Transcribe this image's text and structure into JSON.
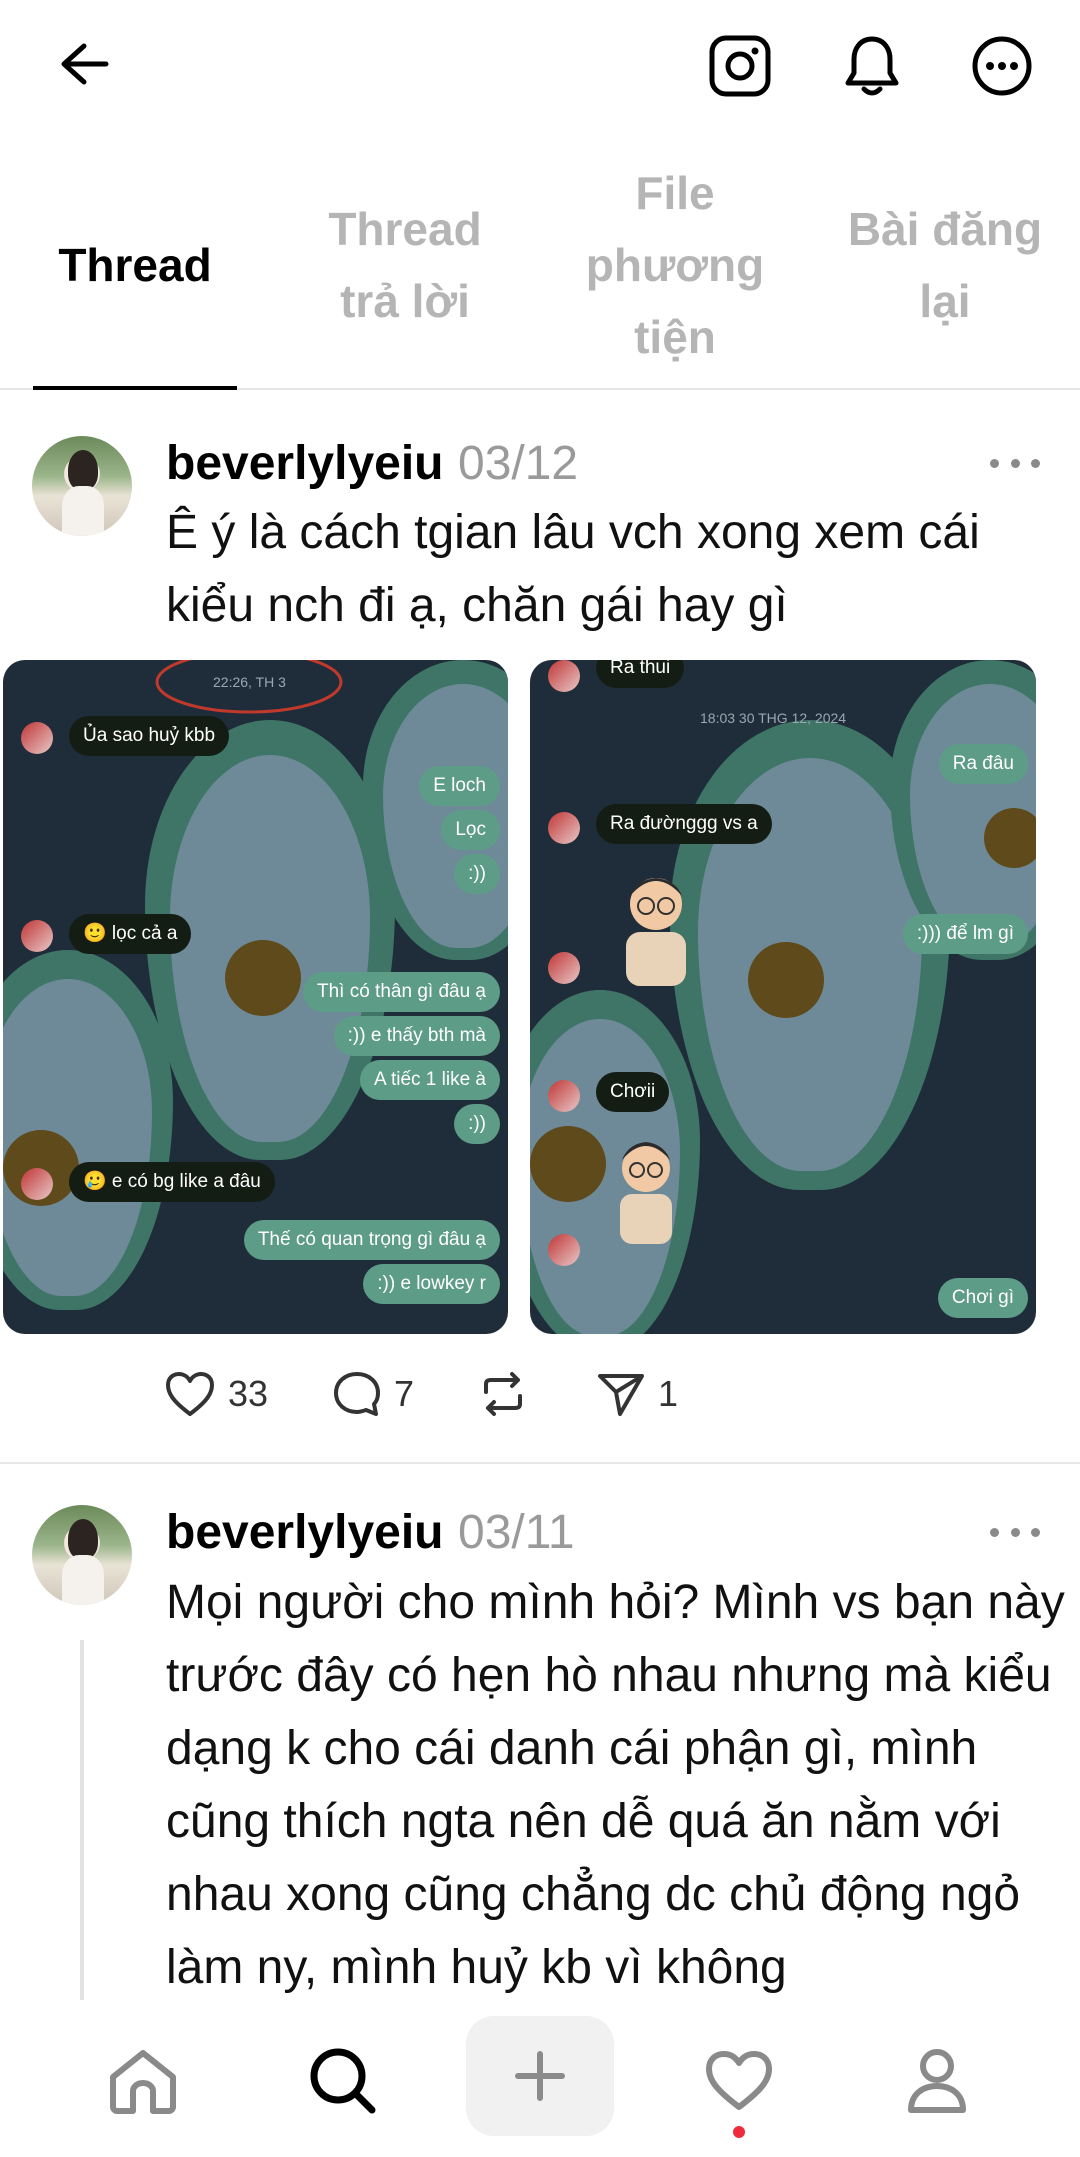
{
  "header": {
    "back_icon": "arrow-left-icon",
    "instagram_icon": "instagram-icon",
    "notifications_icon": "bell-icon",
    "more_icon": "more-circle-icon"
  },
  "tabs": [
    {
      "label": "Thread",
      "active": true
    },
    {
      "label": "Thread trả lời",
      "active": false
    },
    {
      "label": "File phương tiện",
      "active": false
    },
    {
      "label": "Bài đăng lại",
      "active": false
    }
  ],
  "posts": [
    {
      "username": "beverlylyeiu",
      "date": "03/12",
      "text": "Ê ý là cách tgian lâu vch xong xem cái kiểu nch đi ạ, chăn gái hay gì",
      "likes": "33",
      "comments": "7",
      "shares": "1",
      "screenshot1": {
        "timestamp": "22:26, TH 3",
        "messages": [
          {
            "dir": "in",
            "text": "Ủa sao huỷ kbb"
          },
          {
            "dir": "out",
            "text": "E loch"
          },
          {
            "dir": "out",
            "text": "Lọc"
          },
          {
            "dir": "out",
            "text": ":))"
          },
          {
            "dir": "in",
            "text": "🙂 lọc cả a"
          },
          {
            "dir": "out",
            "text": "Thì có thân gì đâu ạ"
          },
          {
            "dir": "out",
            "text": ":)) e thấy bth mà"
          },
          {
            "dir": "out",
            "text": "A tiếc 1 like à"
          },
          {
            "dir": "out",
            "text": ":))"
          },
          {
            "dir": "in",
            "text": "🥲 e có bg like a đâu"
          },
          {
            "dir": "out",
            "text": "Thế có quan trọng gì đâu ạ"
          },
          {
            "dir": "out",
            "text": ":)) e lowkey r"
          }
        ]
      },
      "screenshot2": {
        "timestamp": "18:03 30 THG 12, 2024",
        "messages": [
          {
            "dir": "in",
            "text": "Ra thui"
          },
          {
            "dir": "out",
            "text": "Ra đâu"
          },
          {
            "dir": "in",
            "text": "Ra đườnggg vs a"
          },
          {
            "dir": "out",
            "text": ":))) để lm gì"
          },
          {
            "dir": "in",
            "text": "Chơii"
          },
          {
            "dir": "out",
            "text": "Chơi gì"
          }
        ]
      }
    },
    {
      "username": "beverlylyeiu",
      "date": "03/11",
      "text": "Mọi người cho mình hỏi? Mình vs bạn này trước đây có hẹn hò nhau nhưng mà kiểu dạng k cho cái danh cái phận gì, mình cũng thích ngta nên dễ quá ăn nằm với nhau xong cũng chẳng dc chủ động ngỏ làm ny, mình huỷ kb vì không"
    }
  ],
  "bottom_nav": [
    "home-icon",
    "search-icon",
    "plus-icon",
    "heart-icon",
    "profile-icon"
  ],
  "colors": {
    "bubble_in": "#141d13",
    "bubble_out": "#5d9c87",
    "chat_bg": "#1f2d3a",
    "notification_dot": "#ef2b3d",
    "muted_text": "#9a9a9a"
  }
}
